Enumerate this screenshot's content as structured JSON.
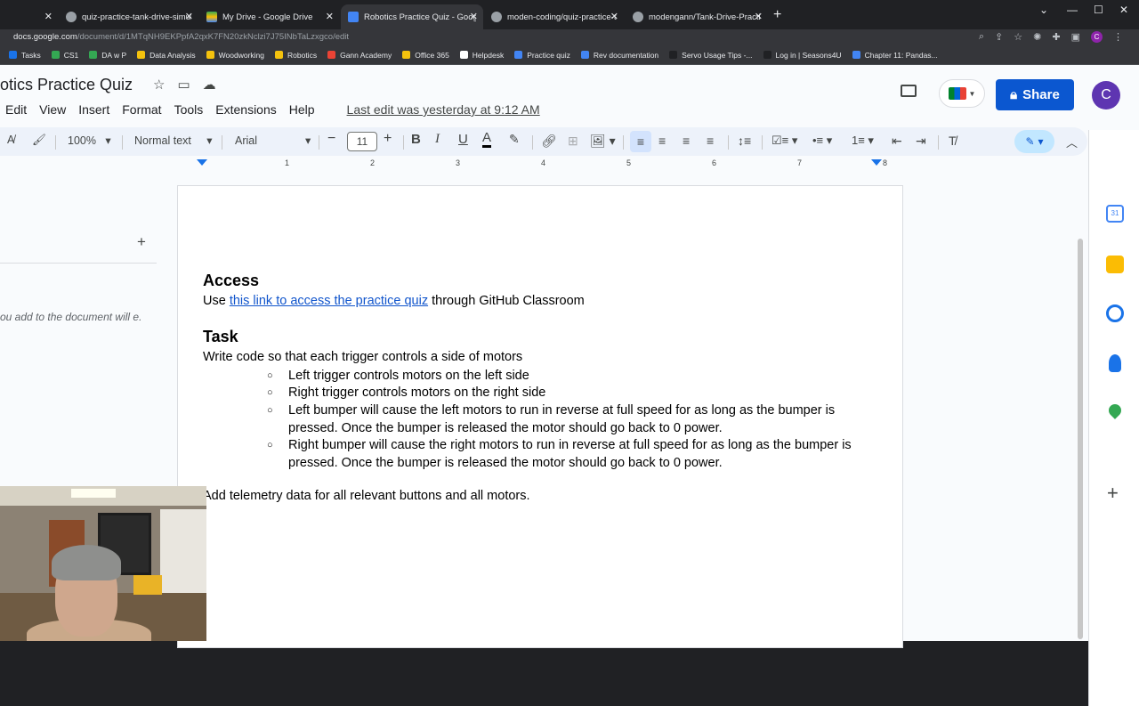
{
  "browser": {
    "tabs": [
      {
        "title": "",
        "active": false
      },
      {
        "title": "quiz-practice-tank-drive-simulati",
        "active": false
      },
      {
        "title": "My Drive - Google Drive",
        "active": false
      },
      {
        "title": "Robotics Practice Quiz - Google",
        "active": true
      },
      {
        "title": "moden-coding/quiz-practice-tan",
        "active": false
      },
      {
        "title": "modengann/Tank-Drive-Practice",
        "active": false
      }
    ],
    "new_tab": "+",
    "url_host": "docs.google.com",
    "url_path": "/document/d/1MTqNH9EKPpfA2qxK7FN20zkNclzi7J75INbTaLzxgco/edit",
    "profile_initial": "C",
    "bookmarks": [
      {
        "label": "Tasks",
        "color": "#1a73e8"
      },
      {
        "label": "CS1",
        "color": "#34a853"
      },
      {
        "label": "DA w P",
        "color": "#34a853"
      },
      {
        "label": "Data Analysis",
        "color": "#f4c20d"
      },
      {
        "label": "Woodworking",
        "color": "#f4c20d"
      },
      {
        "label": "Robotics",
        "color": "#f4c20d"
      },
      {
        "label": "Gann Academy",
        "color": "#ea4335"
      },
      {
        "label": "Office 365",
        "color": "#f4c20d"
      },
      {
        "label": "Helpdesk",
        "color": "#ffffff"
      },
      {
        "label": "Practice quiz",
        "color": "#4285f4"
      },
      {
        "label": "Rev documentation",
        "color": "#4285f4"
      },
      {
        "label": "Servo Usage Tips -...",
        "color": "#202124"
      },
      {
        "label": "Log in | Seasons4U",
        "color": "#202124"
      },
      {
        "label": "Chapter 11: Pandas...",
        "color": "#4285f4"
      }
    ]
  },
  "doc": {
    "title": "otics Practice Quiz",
    "menu": [
      "Edit",
      "View",
      "Insert",
      "Format",
      "Tools",
      "Extensions",
      "Help"
    ],
    "last_edit": "Last edit was yesterday at 9:12 AM",
    "share_label": "Share",
    "account_initial": "C",
    "toolbar": {
      "zoom": "100%",
      "style": "Normal text",
      "font": "Arial",
      "font_size": "11",
      "minus": "−",
      "plus": "+"
    },
    "ruler_numbers": [
      "1",
      "2",
      "3",
      "4",
      "5",
      "6",
      "7",
      "8"
    ],
    "outline_text": "ou add to the document will e.",
    "content": {
      "access_heading": "Access",
      "access_prefix": "Use ",
      "access_link": "this link to access the practice quiz",
      "access_suffix": " through GitHub Classroom",
      "task_heading": "Task",
      "task_intro": "Write code so that each trigger controls a side of motors",
      "bullets": [
        "Left trigger controls motors on the left side",
        "Right trigger controls motors on the right side",
        "Left bumper will cause the left motors to run in reverse at full speed for as long as the bumper is pressed. Once the bumper is released the motor should go back to 0 power.",
        "Right bumper will cause the right motors to run in reverse at full speed for as long as the bumper is pressed. Once the bumper is released the motor should go back to 0 power."
      ],
      "bullet_marker": "○",
      "closing": "Add telemetry data for all relevant buttons and all motors."
    },
    "side_panel": [
      "calendar-icon",
      "keep-icon",
      "tasks-icon",
      "contacts-icon",
      "maps-icon"
    ],
    "accent": "#0b57d0"
  }
}
